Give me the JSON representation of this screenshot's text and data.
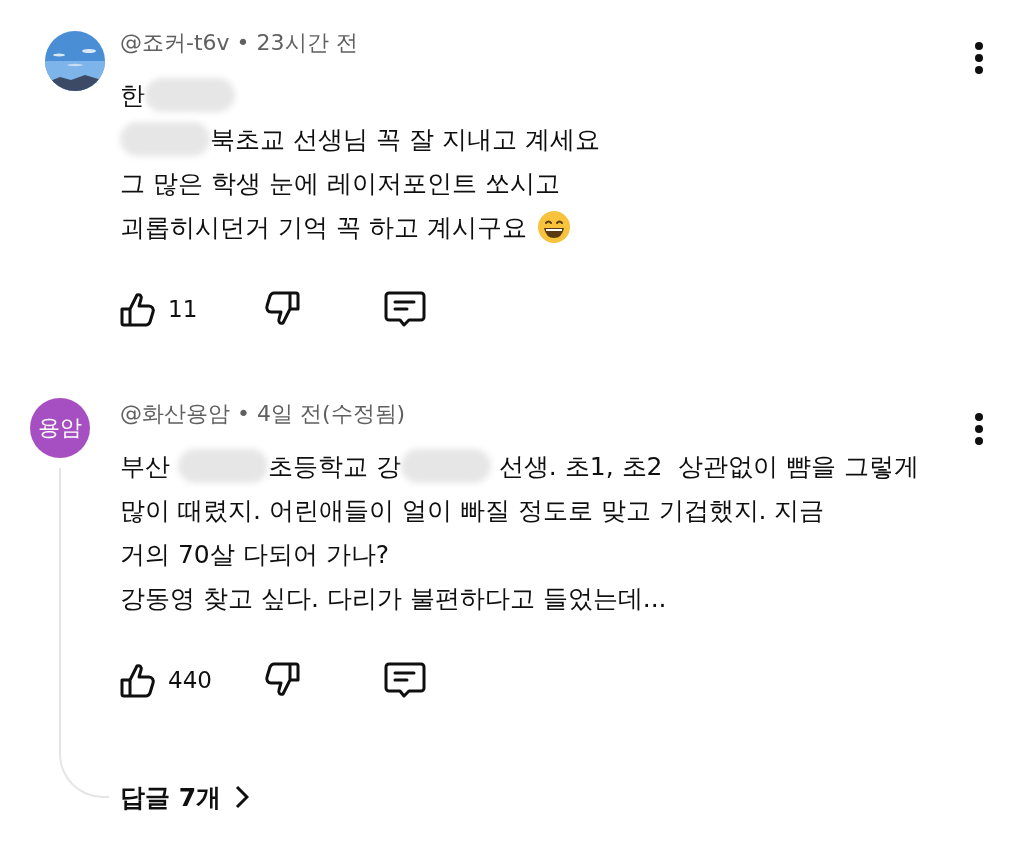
{
  "comments": [
    {
      "avatar": {
        "kind": "picture"
      },
      "header": "@죠커-t6v • 23시간 전",
      "lines": [
        [
          {
            "kind": "text",
            "text": "한"
          },
          {
            "kind": "blur"
          }
        ],
        [
          {
            "kind": "blur"
          },
          {
            "kind": "text",
            "text": "북초교 선생님 꼭 잘 지내고 계세요"
          }
        ],
        [
          {
            "kind": "text",
            "text": "그 많은 학생 눈에 레이저포인트 쏘시고"
          }
        ],
        [
          {
            "kind": "text",
            "text": "괴롭히시던거 기억 꼭 하고 계시구요 "
          },
          {
            "kind": "emoji"
          }
        ]
      ],
      "likes": "11"
    },
    {
      "avatar": {
        "kind": "initials",
        "text": "용암"
      },
      "header": "@화산용암 • 4일 전(수정됨)",
      "lines": [
        [
          {
            "kind": "text",
            "text": "부산 "
          },
          {
            "kind": "blur"
          },
          {
            "kind": "text",
            "text": "초등학교 강"
          },
          {
            "kind": "blur"
          },
          {
            "kind": "text",
            "text": " 선생. 초1, 초2  상관없이 뺨을 그렇게"
          }
        ],
        [
          {
            "kind": "text",
            "text": "많이 때렸지. 어린애들이 얼이 빠질 정도로 맞고 기겁했지. 지금"
          }
        ],
        [
          {
            "kind": "text",
            "text": "거의 70살 다되어 가나?"
          }
        ],
        [
          {
            "kind": "text",
            "text": "강동영 찾고 싶다. 다리가 불편하다고 들었는데..."
          }
        ]
      ],
      "likes": "440",
      "replies": "답글 7개"
    }
  ]
}
